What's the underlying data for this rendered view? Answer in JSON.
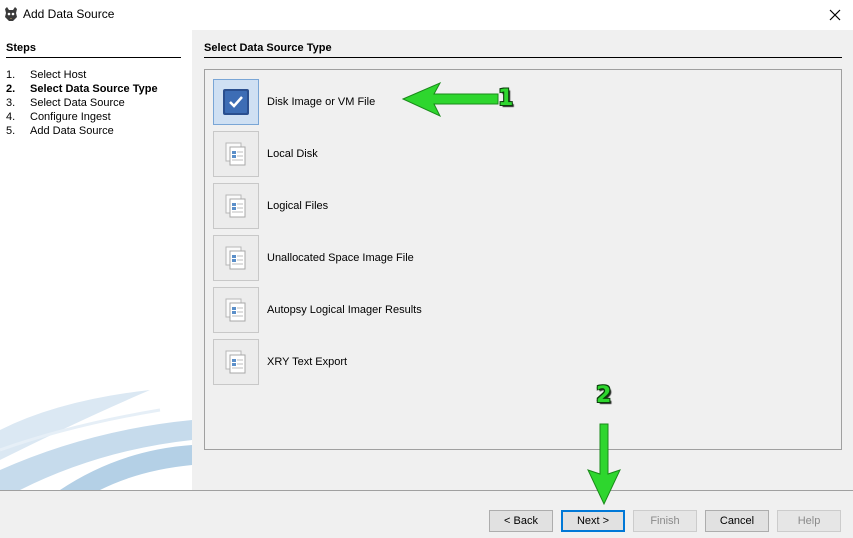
{
  "window": {
    "title": "Add Data Source",
    "icon": "autopsy-dog-icon",
    "close_icon": "close-icon"
  },
  "steps": {
    "heading": "Steps",
    "items": [
      {
        "num": "1.",
        "label": "Select Host",
        "current": false
      },
      {
        "num": "2.",
        "label": "Select Data Source Type",
        "current": true
      },
      {
        "num": "3.",
        "label": "Select Data Source",
        "current": false
      },
      {
        "num": "4.",
        "label": "Configure Ingest",
        "current": false
      },
      {
        "num": "5.",
        "label": "Add Data Source",
        "current": false
      }
    ]
  },
  "content": {
    "heading": "Select Data Source Type",
    "types": [
      {
        "label": "Disk Image or VM File",
        "icon": "checkmark-icon",
        "selected": true
      },
      {
        "label": "Local Disk",
        "icon": "document-stack-icon",
        "selected": false
      },
      {
        "label": "Logical Files",
        "icon": "document-stack-icon",
        "selected": false
      },
      {
        "label": "Unallocated Space Image File",
        "icon": "document-stack-icon",
        "selected": false
      },
      {
        "label": "Autopsy Logical Imager Results",
        "icon": "document-stack-icon",
        "selected": false
      },
      {
        "label": "XRY Text Export",
        "icon": "document-stack-icon",
        "selected": false
      }
    ]
  },
  "annotations": {
    "one": "1",
    "two": "2",
    "color": "#2ed62e"
  },
  "buttons": {
    "back": "< Back",
    "next": "Next >",
    "finish": "Finish",
    "cancel": "Cancel",
    "help": "Help"
  },
  "colors": {
    "selection_fill": "#cfe0f3",
    "selection_border": "#7aa6d6",
    "pane_bg": "#f0f0f0",
    "default_button_border": "#0078d7"
  }
}
